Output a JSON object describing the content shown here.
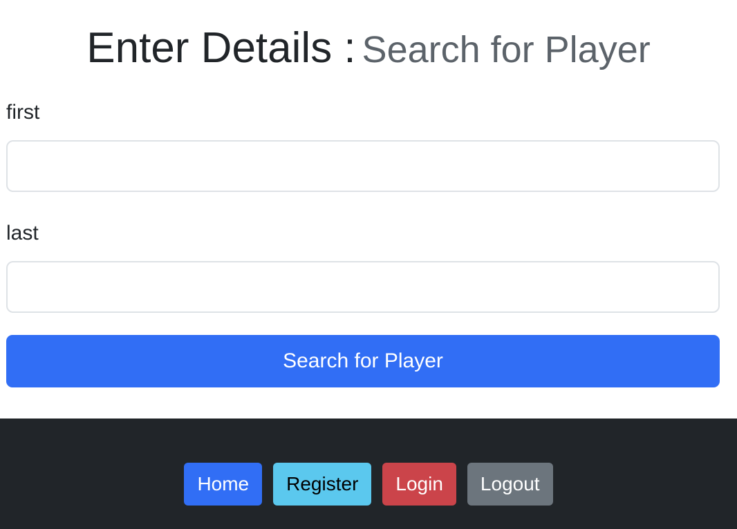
{
  "heading": {
    "main": "Enter Details :",
    "sub": "Search for Player"
  },
  "form": {
    "first": {
      "label": "first",
      "value": "",
      "placeholder": ""
    },
    "last": {
      "label": "last",
      "value": "",
      "placeholder": ""
    },
    "submit_label": "Search for Player"
  },
  "footer": {
    "nav": {
      "home": "Home",
      "register": "Register",
      "login": "Login",
      "logout": "Logout"
    }
  },
  "colors": {
    "primary": "#316ef5",
    "info": "#5bc8ee",
    "danger": "#cb444a",
    "secondary": "#6c757d",
    "footer_bg": "#212529"
  }
}
